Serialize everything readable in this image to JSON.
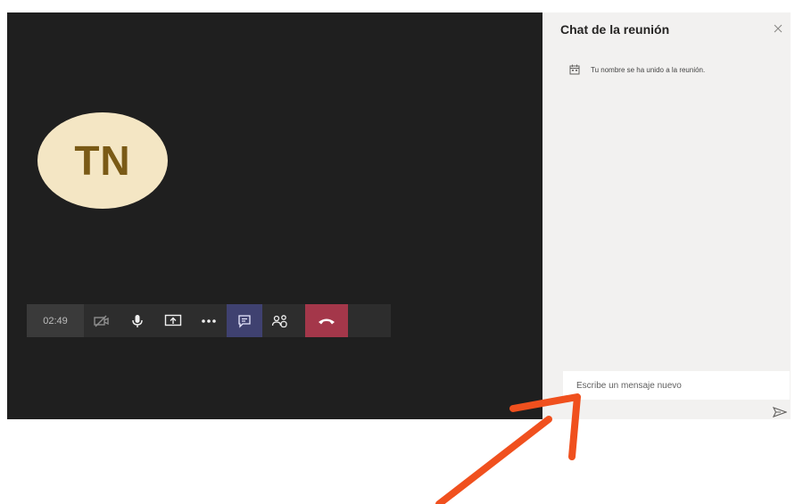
{
  "stage": {
    "avatar_initials": "TN"
  },
  "toolbar": {
    "timer": "02:49",
    "buttons": [
      {
        "icon": "camera-off-icon"
      },
      {
        "icon": "microphone-icon"
      },
      {
        "icon": "share-screen-icon"
      },
      {
        "icon": "more-options-icon"
      },
      {
        "icon": "chat-icon",
        "active": true
      },
      {
        "icon": "participants-icon"
      },
      {
        "icon": "hang-up-icon"
      }
    ]
  },
  "chat": {
    "title": "Chat de la reunión",
    "system_message": "Tu nombre se ha unido a la reunión.",
    "composer_placeholder": "Escribe un mensaje nuevo"
  },
  "colors": {
    "stage_bg": "#1f1f1f",
    "avatar_bg": "#f4e6c4",
    "avatar_text": "#7a5a16",
    "active_button": "#3f4170",
    "hangup_button": "#a4374a",
    "chat_panel": "#f2f1f0",
    "annotation_arrow": "#f0501e"
  }
}
